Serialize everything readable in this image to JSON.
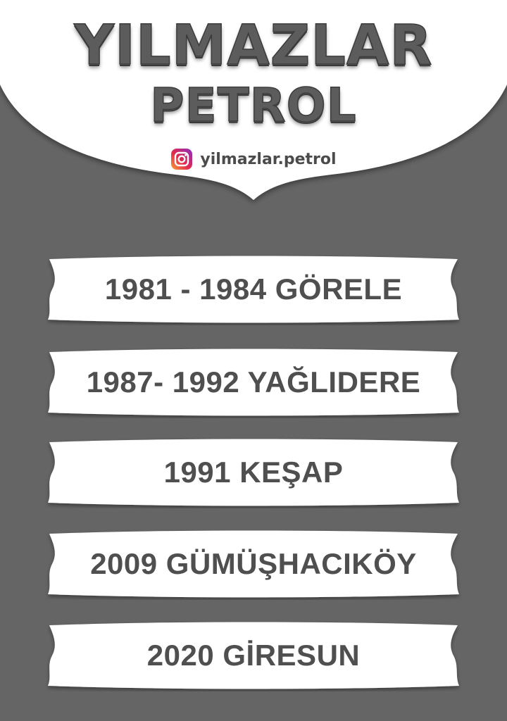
{
  "header": {
    "title_line1": "YILMAZLAR",
    "title_line2": "PETROL",
    "instagram_icon": "instagram-icon",
    "instagram_handle": "yilmazlar.petrol"
  },
  "locations": [
    {
      "label": "1981 - 1984 GÖRELE"
    },
    {
      "label": "1987- 1992 YAĞLIDERE"
    },
    {
      "label": "1991 KEŞAP"
    },
    {
      "label": "2009 GÜMÜŞHACIKÖY"
    },
    {
      "label": "2020 GİRESUN"
    }
  ],
  "colors": {
    "background": "#656565",
    "header": "#ffffff",
    "banner": "#ffffff",
    "text": "#4f4f4f"
  }
}
